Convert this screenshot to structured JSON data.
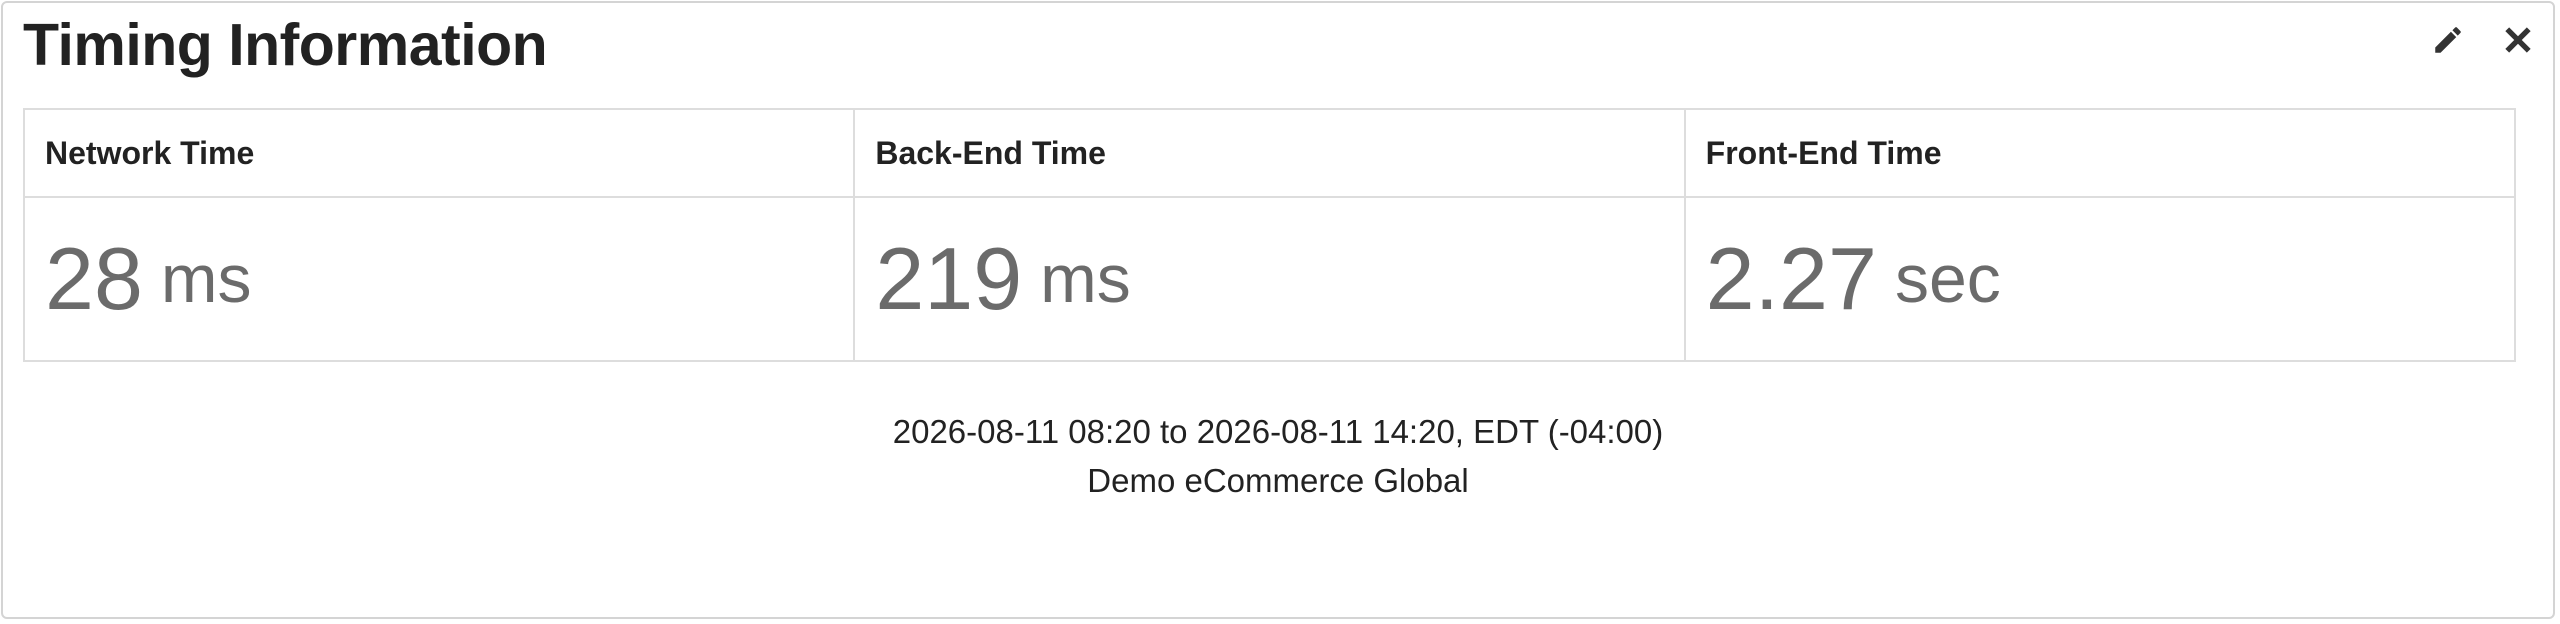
{
  "widget": {
    "title": "Timing Information",
    "icons": {
      "edit": "pencil-icon",
      "close": "close-icon"
    }
  },
  "metrics": [
    {
      "label": "Network Time",
      "value": "28",
      "unit": "ms"
    },
    {
      "label": "Back-End Time",
      "value": "219",
      "unit": "ms"
    },
    {
      "label": "Front-End Time",
      "value": "2.27",
      "unit": "sec"
    }
  ],
  "footer": {
    "time_range": "2026-08-11 08:20 to 2026-08-11 14:20, EDT (-04:00)",
    "application": "Demo eCommerce Global"
  },
  "colors": {
    "title": "#222222",
    "metric_value": "#6b6b6b",
    "border": "#dddddd"
  }
}
